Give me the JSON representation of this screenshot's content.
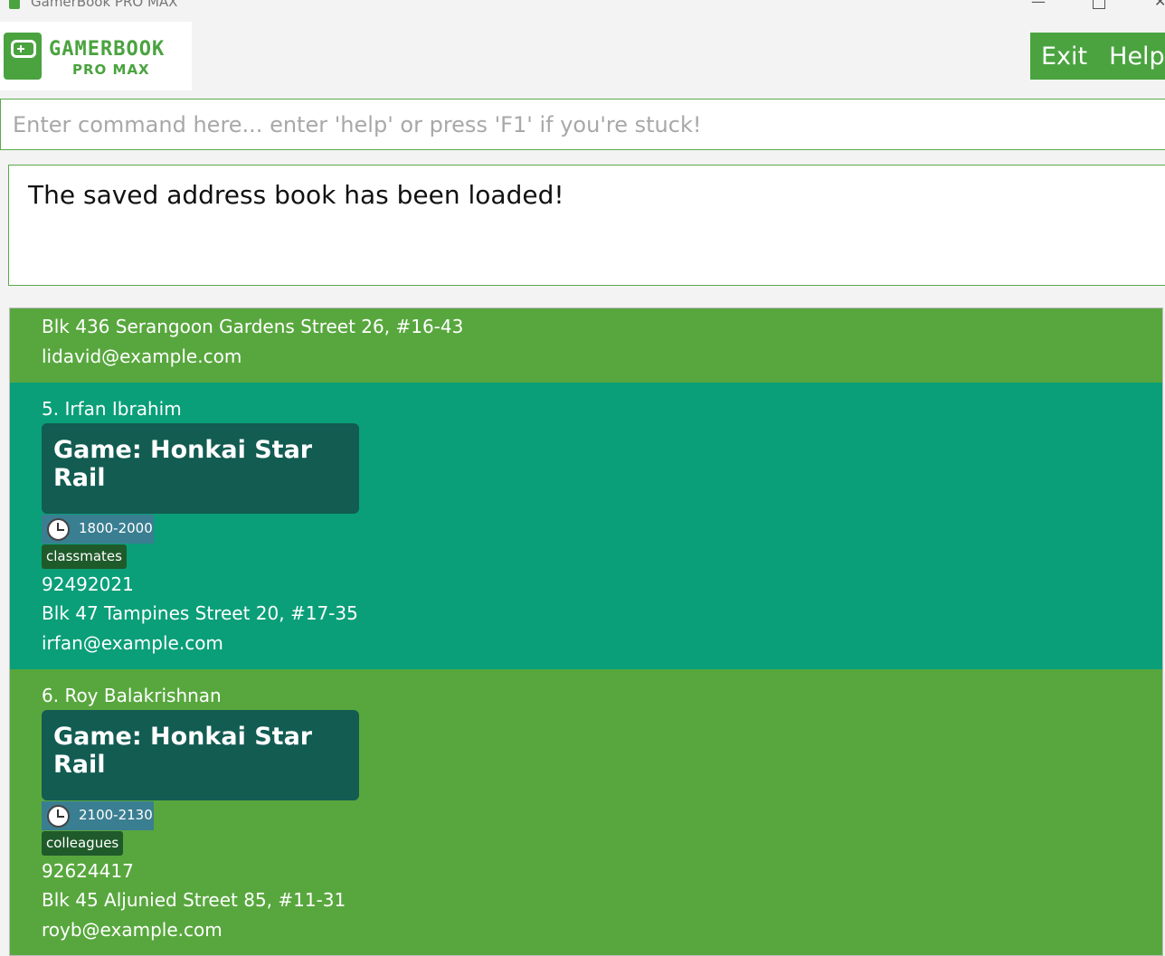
{
  "window": {
    "title": "GamerBook PRO MAX"
  },
  "logo": {
    "line1": "GAMERBOOK",
    "line2": "PRO MAX"
  },
  "menu": {
    "exit": "Exit",
    "help": "Help"
  },
  "command": {
    "placeholder": "Enter command here... enter 'help' or press 'F1' if you're stuck!",
    "value": ""
  },
  "result": {
    "message": "The saved address book has been loaded!"
  },
  "persons": [
    {
      "address": "Blk 436 Serangoon Gardens Street 26, #16-43",
      "email": "lidavid@example.com"
    },
    {
      "name": "5. Irfan Ibrahim",
      "game": "Game: Honkai Star Rail",
      "time": "1800-2000",
      "tag": "classmates",
      "phone": "92492021",
      "address": "Blk 47 Tampines Street 20, #17-35",
      "email": "irfan@example.com"
    },
    {
      "name": "6. Roy Balakrishnan",
      "game": "Game: Honkai Star Rail",
      "time": "2100-2130",
      "tag": "colleagues",
      "phone": "92624417",
      "address": "Blk 45 Aljunied Street 85, #11-31",
      "email": "royb@example.com"
    }
  ],
  "colors": {
    "accent": "#4aa33f",
    "card_green": "#58a73e",
    "card_teal": "#0a9f78",
    "game_box": "#125c52",
    "time_badge": "#3a7e91",
    "tag": "#1f5a2b"
  }
}
